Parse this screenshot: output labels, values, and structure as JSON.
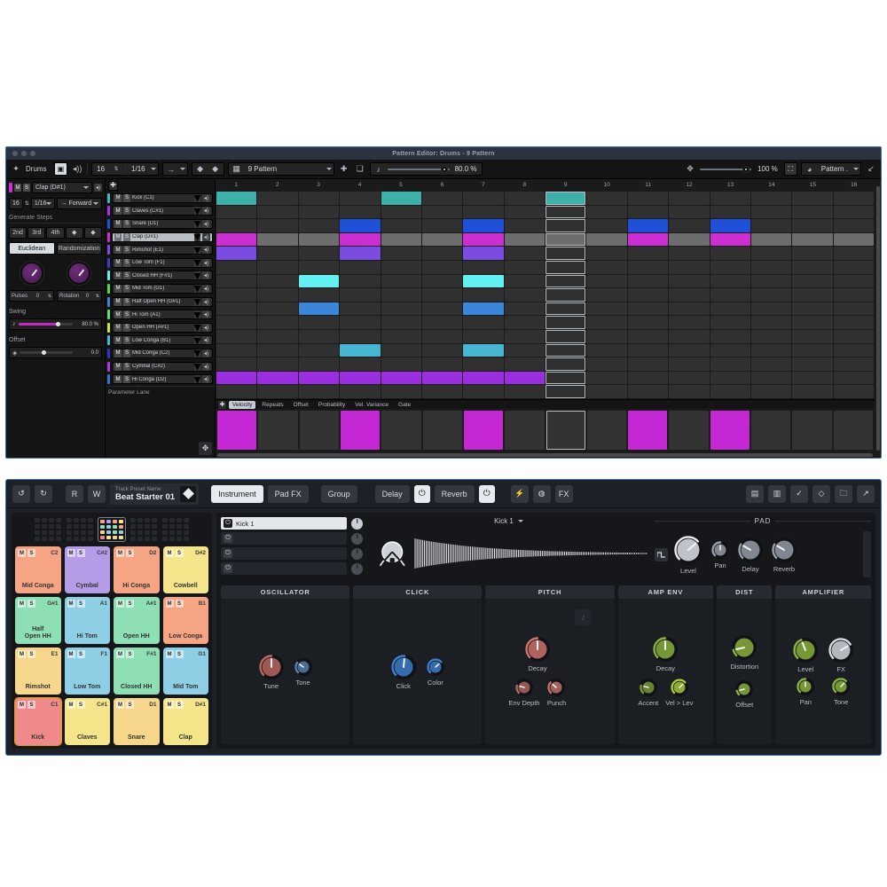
{
  "pattern_editor": {
    "title": "Pattern Editor: Drums - 9 Pattern",
    "toolbar": {
      "pin_icon": "pin-icon",
      "track_name": "Drums",
      "view_toggle_icon": "single-view-icon",
      "monitor_icon": "speaker-icon",
      "steps": "16",
      "rate": "1/16",
      "direction_icon": "arrow-right-icon",
      "nudge_left_icon": "nudge-left-icon",
      "nudge_right_icon": "nudge-right-icon",
      "pattern_icon": "pattern-grid-icon",
      "pattern_name": "9 Pattern",
      "add_icon": "plus-icon",
      "duplicate_icon": "duplicate-icon",
      "swing_icon": "swing-icon",
      "swing_value": "80.0 %",
      "zoom_icon": "zoom-icon",
      "zoom_value": "100 %",
      "fit_icon": "fit-icon",
      "view_mode": "Pattern .",
      "collapse_icon": "collapse-icon"
    },
    "generate_panel": {
      "selected_track": "Clap (D#1)",
      "mute_label": "M",
      "solo_label": "S",
      "speaker_icon": "speaker-icon",
      "steps": "16",
      "rate": "1/16",
      "play_direction": "Forward",
      "direction_icon": "arrow-right-icon",
      "section_title": "Generate Steps",
      "quick_steps": [
        "2nd",
        "3rd",
        "4th"
      ],
      "nudge_left_icon": "nudge-left-icon",
      "nudge_right_icon": "nudge-right-icon",
      "modes": [
        "Euclidean",
        "Randomization"
      ],
      "active_mode": "Euclidean",
      "pulses_label": "Pulses",
      "pulses_value": "0",
      "rotation_label": "Rotation",
      "rotation_value": "0",
      "swing_label": "Swing",
      "swing_value": "80.0 %",
      "swing_pct": 72,
      "offset_label": "Offset",
      "offset_value": "0.0",
      "offset_pct": 45
    },
    "tracks": [
      {
        "name": "Kick (C1)",
        "color": "#3eb9b2"
      },
      {
        "name": "Claves (C#1)",
        "color": "#a832e0"
      },
      {
        "name": "Snare (D1)",
        "color": "#2050d8"
      },
      {
        "name": "Clap (D#1)",
        "color": "#cc2ed4",
        "selected": true
      },
      {
        "name": "Rimshot (E1)",
        "color": "#7b4ce0"
      },
      {
        "name": "Low Tom (F1)",
        "color": "#4038c8"
      },
      {
        "name": "Closed HH (F#1)",
        "color": "#63f0f0"
      },
      {
        "name": "Mid Tom (G1)",
        "color": "#52d94a"
      },
      {
        "name": "Half Open HH (G#1)",
        "color": "#3a86d8"
      },
      {
        "name": "Hi Tom (A1)",
        "color": "#5ce07a"
      },
      {
        "name": "Open HH (A#1)",
        "color": "#c2e832"
      },
      {
        "name": "Low Conga (B1)",
        "color": "#48b6d2"
      },
      {
        "name": "Mid Conga (C2)",
        "color": "#2a36c8"
      },
      {
        "name": "Cymbal (C#2)",
        "color": "#b432e0"
      },
      {
        "name": "Hi Conga (D2)",
        "color": "#3a6ed8"
      }
    ],
    "parameter_lane_label": "Parameter Lane",
    "ruler": [
      "1",
      "2",
      "3",
      "4",
      "5",
      "6",
      "7",
      "8",
      "9",
      "10",
      "11",
      "12",
      "13",
      "14",
      "15",
      "16"
    ],
    "selected_column": 9,
    "steps": [
      {
        "track": 0,
        "cells": [
          1,
          0,
          0,
          0,
          1,
          0,
          0,
          0,
          1,
          0,
          0,
          0,
          0,
          0,
          0,
          0
        ],
        "color": "#3eb0aa"
      },
      {
        "track": 1,
        "cells": [
          0,
          0,
          0,
          0,
          0,
          0,
          0,
          0,
          0,
          0,
          0,
          0,
          0,
          0,
          0,
          0
        ],
        "color": "#a832e0"
      },
      {
        "track": 2,
        "cells": [
          0,
          0,
          0,
          1,
          0,
          0,
          1,
          0,
          0,
          0,
          1,
          0,
          1,
          0,
          0,
          0
        ],
        "color": "#2050d8"
      },
      {
        "track": 3,
        "cells": [
          1,
          2,
          2,
          1,
          2,
          2,
          1,
          2,
          2,
          2,
          1,
          2,
          1,
          2,
          2,
          2
        ],
        "color": "#cc2ed4",
        "alt": "#6d6d6d"
      },
      {
        "track": 4,
        "cells": [
          1,
          0,
          0,
          1,
          0,
          0,
          1,
          0,
          0,
          0,
          0,
          0,
          0,
          0,
          0,
          0
        ],
        "color": "#7b4ce0"
      },
      {
        "track": 5,
        "cells": [
          0,
          0,
          0,
          0,
          0,
          0,
          0,
          0,
          0,
          0,
          0,
          0,
          0,
          0,
          0,
          0
        ],
        "color": "#4038c8"
      },
      {
        "track": 6,
        "cells": [
          0,
          0,
          1,
          0,
          0,
          0,
          1,
          0,
          0,
          0,
          0,
          0,
          0,
          0,
          0,
          0
        ],
        "color": "#63f0f0"
      },
      {
        "track": 7,
        "cells": [
          0,
          0,
          0,
          0,
          0,
          0,
          0,
          0,
          0,
          0,
          0,
          0,
          0,
          0,
          0,
          0
        ],
        "color": "#52d94a"
      },
      {
        "track": 8,
        "cells": [
          0,
          0,
          1,
          0,
          0,
          0,
          1,
          0,
          0,
          0,
          0,
          0,
          0,
          0,
          0,
          0
        ],
        "color": "#3a86d8"
      },
      {
        "track": 9,
        "cells": [
          0,
          0,
          0,
          0,
          0,
          0,
          0,
          0,
          0,
          0,
          0,
          0,
          0,
          0,
          0,
          0
        ],
        "color": "#5ce07a"
      },
      {
        "track": 10,
        "cells": [
          0,
          0,
          0,
          0,
          0,
          0,
          0,
          0,
          0,
          0,
          0,
          0,
          0,
          0,
          0,
          0
        ],
        "color": "#c2e832"
      },
      {
        "track": 11,
        "cells": [
          0,
          0,
          0,
          1,
          0,
          0,
          1,
          0,
          0,
          0,
          0,
          0,
          0,
          0,
          0,
          0
        ],
        "color": "#48b6d2"
      },
      {
        "track": 12,
        "cells": [
          0,
          0,
          0,
          0,
          0,
          0,
          0,
          0,
          0,
          0,
          0,
          0,
          0,
          0,
          0,
          0
        ],
        "color": "#2a36c8"
      },
      {
        "track": 13,
        "cells": [
          1,
          1,
          1,
          1,
          1,
          1,
          1,
          1,
          0,
          0,
          0,
          0,
          0,
          0,
          0,
          0
        ],
        "color": "#9b2ee0"
      },
      {
        "track": 14,
        "cells": [
          0,
          0,
          0,
          0,
          0,
          0,
          0,
          0,
          0,
          0,
          0,
          0,
          0,
          0,
          0,
          0
        ],
        "color": "#3a6ed8"
      }
    ],
    "lane_tabs": [
      "Velocity",
      "Repeats",
      "Offset",
      "Probability",
      "Vel. Variance",
      "Gate"
    ],
    "active_lane_tab": "Velocity",
    "velocity_bars": [
      1,
      0,
      0,
      1,
      0,
      0,
      1,
      0,
      0,
      0,
      1,
      0,
      1,
      0,
      0,
      0
    ],
    "velocity_color": "#c328d4",
    "add_lane_icon": "plus-icon"
  },
  "instrument": {
    "toolbar": {
      "undo_icon": "undo-icon",
      "redo_icon": "redo-icon",
      "read_label": "R",
      "write_label": "W",
      "preset_caption": "Track Preset Name",
      "preset_name": "Beat Starter 01",
      "preset_icon": "diamond-icon",
      "tabs": [
        "Instrument",
        "Pad FX",
        "Group"
      ],
      "active_tab": "Instrument",
      "delay_label": "Delay",
      "delay_power_icon": "power-icon",
      "reverb_label": "Reverb",
      "reverb_power_icon": "power-icon",
      "bolt_icon": "bolt-icon",
      "mod_icon": "modulation-icon",
      "fx_label": "FX",
      "right_icons": [
        "save-icon",
        "save-as-icon",
        "check-icon",
        "diamond-icon",
        "folder-icon",
        "expand-icon"
      ]
    },
    "pads": {
      "banks": 5,
      "active_bank": 2,
      "items": [
        {
          "note": "C2",
          "name": "Mid Conga",
          "color": "#f5a584"
        },
        {
          "note": "C#2",
          "name": "Cymbal",
          "color": "#b49ce6"
        },
        {
          "note": "D2",
          "name": "Hi Conga",
          "color": "#f5a584"
        },
        {
          "note": "D#2",
          "name": "Cowbell",
          "color": "#f5e58a"
        },
        {
          "note": "G#1",
          "name": "Half\nOpen HH",
          "color": "#8ee0b4"
        },
        {
          "note": "A1",
          "name": "Hi Tom",
          "color": "#8ecfe6"
        },
        {
          "note": "A#1",
          "name": "Open HH",
          "color": "#8ee0b4"
        },
        {
          "note": "B1",
          "name": "Low Conga",
          "color": "#f5a584"
        },
        {
          "note": "E1",
          "name": "Rimshot",
          "color": "#f5d68a"
        },
        {
          "note": "F1",
          "name": "Low Tom",
          "color": "#8ecfe6"
        },
        {
          "note": "F#1",
          "name": "Closed HH",
          "color": "#8ee0b4"
        },
        {
          "note": "G1",
          "name": "Mid Tom",
          "color": "#8ecfe6"
        },
        {
          "note": "C1",
          "name": "Kick",
          "color": "#f08a8a",
          "selected": true
        },
        {
          "note": "C#1",
          "name": "Claves",
          "color": "#f5e58a"
        },
        {
          "note": "D1",
          "name": "Snare",
          "color": "#f5d68a"
        },
        {
          "note": "D#1",
          "name": "Clap",
          "color": "#f5e58a"
        }
      ],
      "mute_label": "M",
      "solo_label": "S"
    },
    "slots": [
      {
        "name": "Kick 1",
        "on": true
      },
      {
        "name": "",
        "on": false
      },
      {
        "name": "",
        "on": false
      },
      {
        "name": "",
        "on": false
      }
    ],
    "engine": {
      "name": "Kick 1",
      "dropdown_icon": "chevron-down-icon",
      "instrument_icon": "kick-drum-icon",
      "waveform_icon": "waveform-display"
    },
    "pad_section": {
      "title": "PAD",
      "shape_icon": "square-wave-icon",
      "knobs": [
        {
          "label": "Level",
          "value": 68,
          "color": "#e8ecf1",
          "size": "lg"
        },
        {
          "label": "Pan",
          "value": 50,
          "color": "#9aa1ab",
          "size": "sm"
        },
        {
          "label": "Delay",
          "value": 28,
          "color": "#9aa1ab",
          "size": "md"
        },
        {
          "label": "Reverb",
          "value": 28,
          "color": "#9aa1ab",
          "size": "md"
        }
      ],
      "meter_icon": "level-meter"
    },
    "panels": [
      {
        "title": "OSCILLATOR",
        "knobs": [
          {
            "label": "Tune",
            "value": 50,
            "color": "#c06a64",
            "size": "md"
          },
          {
            "label": "Tone",
            "value": 30,
            "color": "#5b7fae",
            "size": "sm"
          }
        ]
      },
      {
        "title": "CLICK",
        "knobs": [
          {
            "label": "Click",
            "value": 52,
            "color": "#3f7fd0",
            "size": "md"
          },
          {
            "label": "Color",
            "value": 68,
            "color": "#3f7fd0",
            "size": "sm"
          }
        ]
      },
      {
        "title": "PITCH",
        "knobs": [
          {
            "label": "Decay",
            "value": 50,
            "color": "#d4756e",
            "size": "md"
          },
          {
            "label": "Env Depth",
            "value": 22,
            "color": "#b06a64",
            "size": "sm"
          },
          {
            "label": "Punch",
            "value": 32,
            "color": "#c4726c",
            "size": "sm"
          }
        ],
        "note_icon": "note-icon"
      },
      {
        "title": "AMP ENV",
        "knobs": [
          {
            "label": "Decay",
            "value": 50,
            "color": "#8cb43c",
            "size": "md"
          },
          {
            "label": "Accent",
            "value": 22,
            "color": "#7d9e38",
            "size": "sm"
          },
          {
            "label": "Vel > Lev",
            "value": 68,
            "color": "#a8cc3c",
            "size": "sm"
          }
        ]
      },
      {
        "title": "DIST",
        "knobs": [
          {
            "label": "Distortion",
            "value": 12,
            "color": "#8cb43c",
            "size": "md"
          },
          {
            "label": "Offset",
            "value": 12,
            "color": "#8cb43c",
            "size": "sm"
          }
        ]
      },
      {
        "title": "AMPLIFIER",
        "knobs": [
          {
            "label": "Level",
            "value": 42,
            "color": "#8cb43c",
            "size": "md"
          },
          {
            "label": "FX",
            "value": 72,
            "color": "#d8dde4",
            "size": "md"
          },
          {
            "label": "Pan",
            "value": 50,
            "color": "#8cb43c",
            "size": "sm"
          },
          {
            "label": "Tone",
            "value": 66,
            "color": "#8cb43c",
            "size": "sm"
          }
        ]
      }
    ]
  }
}
